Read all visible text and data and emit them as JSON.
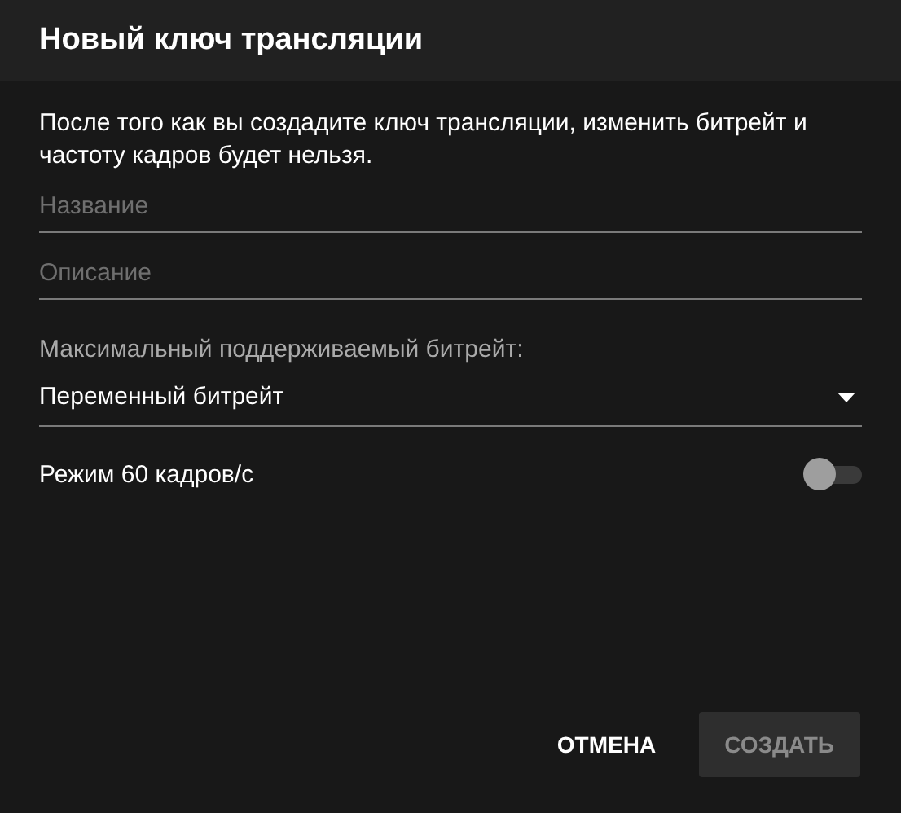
{
  "dialog": {
    "title": "Новый ключ трансляции",
    "notice": "После того как вы создадите ключ трансляции, изменить битрейт и частоту кадров будет нельзя.",
    "fields": [
      {
        "placeholder": "Название"
      },
      {
        "placeholder": "Описание"
      }
    ],
    "bitrate": {
      "label": "Максимальный поддерживаемый битрейт:",
      "value": "Переменный битрейт"
    },
    "fps_toggle": {
      "label": "Режим 60 кадров/с",
      "on": false
    },
    "buttons": [
      {
        "label": "ОТМЕНА",
        "kind": "text",
        "disabled": false
      },
      {
        "label": "СОЗДАТЬ",
        "kind": "filled",
        "disabled": true
      }
    ]
  }
}
